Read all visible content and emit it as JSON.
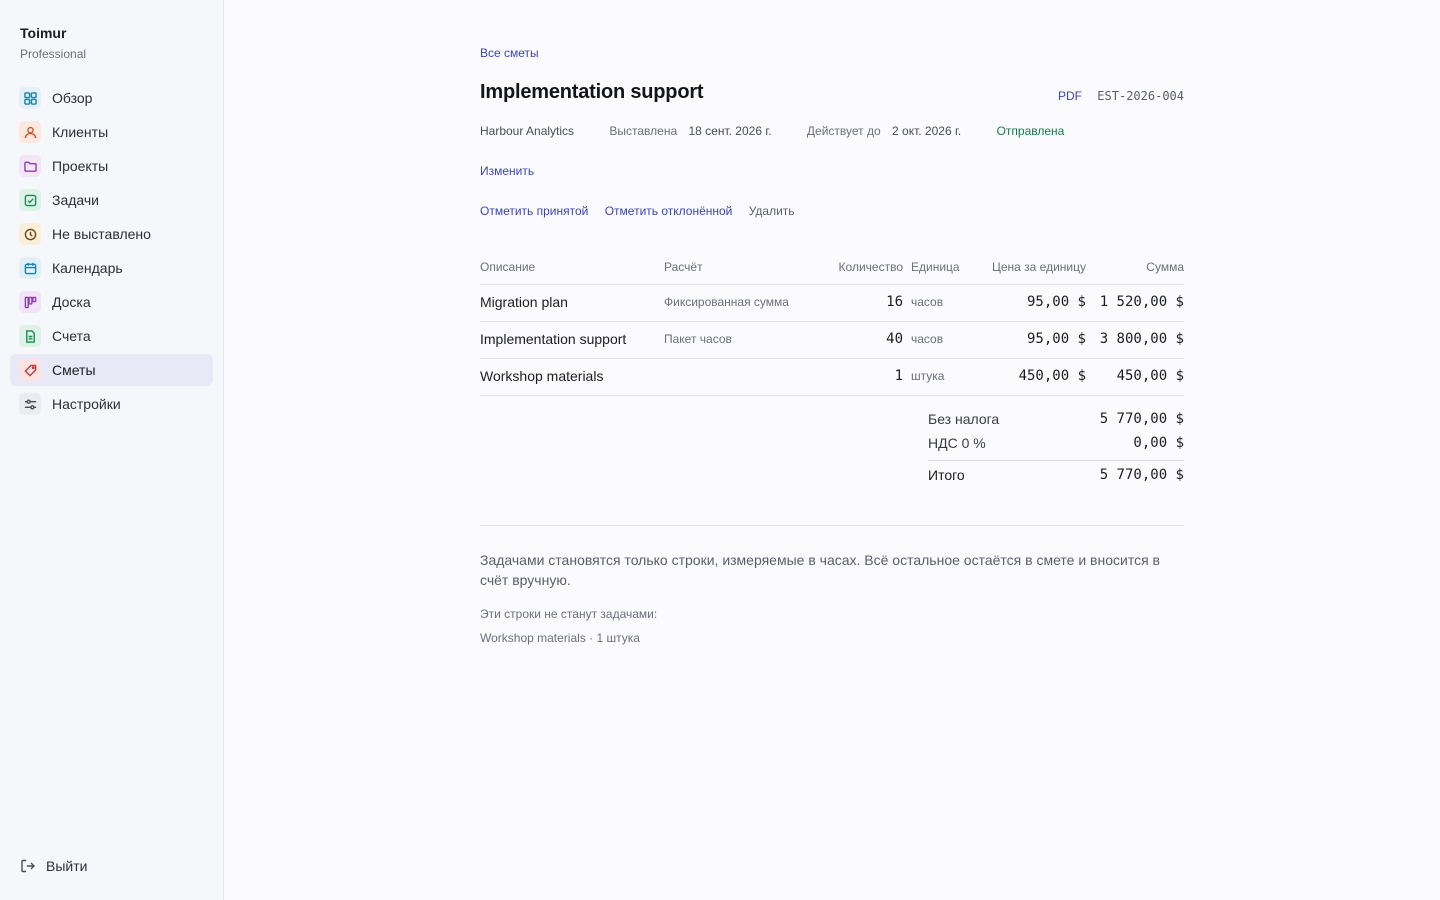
{
  "brand": {
    "name": "Toimur",
    "plan": "Professional"
  },
  "nav": [
    {
      "label": "Обзор",
      "icon": "grid-icon",
      "color": "#1f7fa6",
      "bg": "#e1f1f7"
    },
    {
      "label": "Клиенты",
      "icon": "user-icon",
      "color": "#c4572a",
      "bg": "#fbe8df"
    },
    {
      "label": "Проекты",
      "icon": "folder-icon",
      "color": "#8a3fb0",
      "bg": "#f2e5f7"
    },
    {
      "label": "Задачи",
      "icon": "checkbox-icon",
      "color": "#1d8a52",
      "bg": "#dff2e7"
    },
    {
      "label": "Не выставлено",
      "icon": "clock-icon",
      "color": "#b0761c",
      "bg": "#fbefd9"
    },
    {
      "label": "Календарь",
      "icon": "calendar-icon",
      "color": "#1f7fa6",
      "bg": "#dff0f7"
    },
    {
      "label": "Доска",
      "icon": "board-icon",
      "color": "#8a3fb0",
      "bg": "#f1e4f6"
    },
    {
      "label": "Счета",
      "icon": "document-icon",
      "color": "#1d8a52",
      "bg": "#dff2e7"
    },
    {
      "label": "Сметы",
      "icon": "tag-icon",
      "color": "#c43a3a",
      "bg": "#fbe3e3"
    },
    {
      "label": "Настройки",
      "icon": "sliders-icon",
      "color": "#4a4d56",
      "bg": "#ebecf0"
    }
  ],
  "logout": {
    "label": "Выйти"
  },
  "estimate": {
    "back": "Все сметы",
    "title": "Implementation support",
    "pdf": "PDF",
    "number": "EST-2026-004",
    "client": "Harbour Analytics",
    "issued_label": "Выставлена",
    "issued": "18 сент. 2026 г.",
    "valid_label": "Действует до",
    "valid": "2 окт. 2026 г.",
    "status": "Отправлена",
    "edit": "Изменить",
    "mark_accepted": "Отметить принятой",
    "mark_rejected": "Отметить отклонённой",
    "delete": "Удалить"
  },
  "table": {
    "headers": {
      "desc": "Описание",
      "calc": "Расчёт",
      "qty": "Количество",
      "unit": "Единица",
      "price": "Цена за единицу",
      "sum": "Сумма"
    },
    "rows": [
      {
        "desc": "Migration plan",
        "calc": "Фиксированная сумма",
        "qty": "16",
        "unit": "часов",
        "price": "95,00 $",
        "sum": "1 520,00 $"
      },
      {
        "desc": "Implementation support",
        "calc": "Пакет часов",
        "qty": "40",
        "unit": "часов",
        "price": "95,00 $",
        "sum": "3 800,00 $"
      },
      {
        "desc": "Workshop materials",
        "calc": "",
        "qty": "1",
        "unit": "штука",
        "price": "450,00 $",
        "sum": "450,00 $"
      }
    ]
  },
  "totals": {
    "subtotal_label": "Без налога",
    "subtotal": "5 770,00 $",
    "tax_label": "НДС 0 %",
    "tax": "0,00 $",
    "total_label": "Итого",
    "total": "5 770,00 $"
  },
  "note": {
    "text": "Задачами становятся только строки, измеряемые в часах. Всё остальное остаётся в смете и вносится в счёт вручную.",
    "label": "Эти строки не станут задачами:",
    "item": "Workshop materials · 1 штука"
  }
}
